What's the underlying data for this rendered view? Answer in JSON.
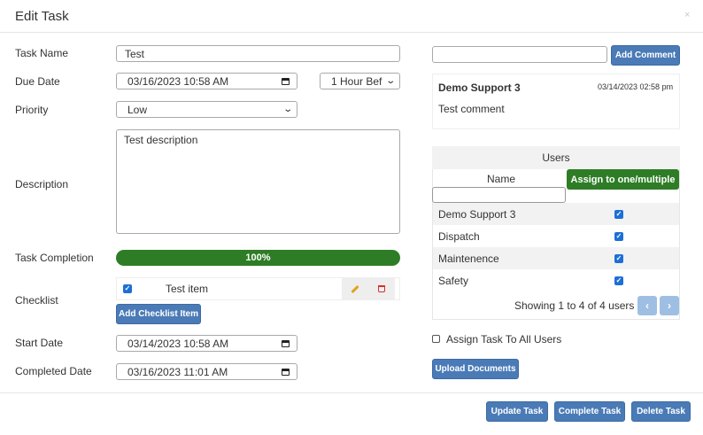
{
  "modal": {
    "title": "Edit Task",
    "close": "×"
  },
  "form": {
    "task_name_label": "Task Name",
    "task_name_value": "Test",
    "due_date_label": "Due Date",
    "due_date_value": "03/16/2023 10:58 AM",
    "reminder_value": "1 Hour Bef",
    "priority_label": "Priority",
    "priority_value": "Low",
    "description_label": "Description",
    "description_value": "Test description",
    "completion_label": "Task Completion",
    "completion_value": "100%",
    "completion_fraction": 1.0,
    "checklist_label": "Checklist",
    "checklist_items": [
      {
        "text": "Test item",
        "checked": true
      }
    ],
    "add_checklist_label": "Add Checklist Item",
    "start_date_label": "Start Date",
    "start_date_value": "03/14/2023 10:58 AM",
    "completed_date_label": "Completed Date",
    "completed_date_value": "03/16/2023 11:01 AM"
  },
  "comments": {
    "input_value": "",
    "add_label": "Add Comment",
    "items": [
      {
        "author": "Demo Support 3",
        "time": "03/14/2023 02:58 pm",
        "text": "Test comment"
      }
    ]
  },
  "users": {
    "header": "Users",
    "name_column": "Name",
    "assign_label": "Assign to one/multiple",
    "filter_value": "",
    "rows": [
      {
        "name": "Demo Support 3",
        "assigned": true
      },
      {
        "name": "Dispatch",
        "assigned": true
      },
      {
        "name": "Maintenence",
        "assigned": true
      },
      {
        "name": "Safety",
        "assigned": true
      }
    ],
    "showing_text": "Showing 1 to 4 of 4 users",
    "assign_all_label": "Assign Task To All Users",
    "upload_label": "Upload Documents"
  },
  "footer": {
    "update_label": "Update Task",
    "complete_label": "Complete Task",
    "delete_label": "Delete Task"
  },
  "colors": {
    "primary": "#4a7bb7",
    "success": "#2e7d26",
    "checkbox": "#1d6fd6",
    "danger": "#d9302c",
    "warning": "#e3a21a"
  }
}
